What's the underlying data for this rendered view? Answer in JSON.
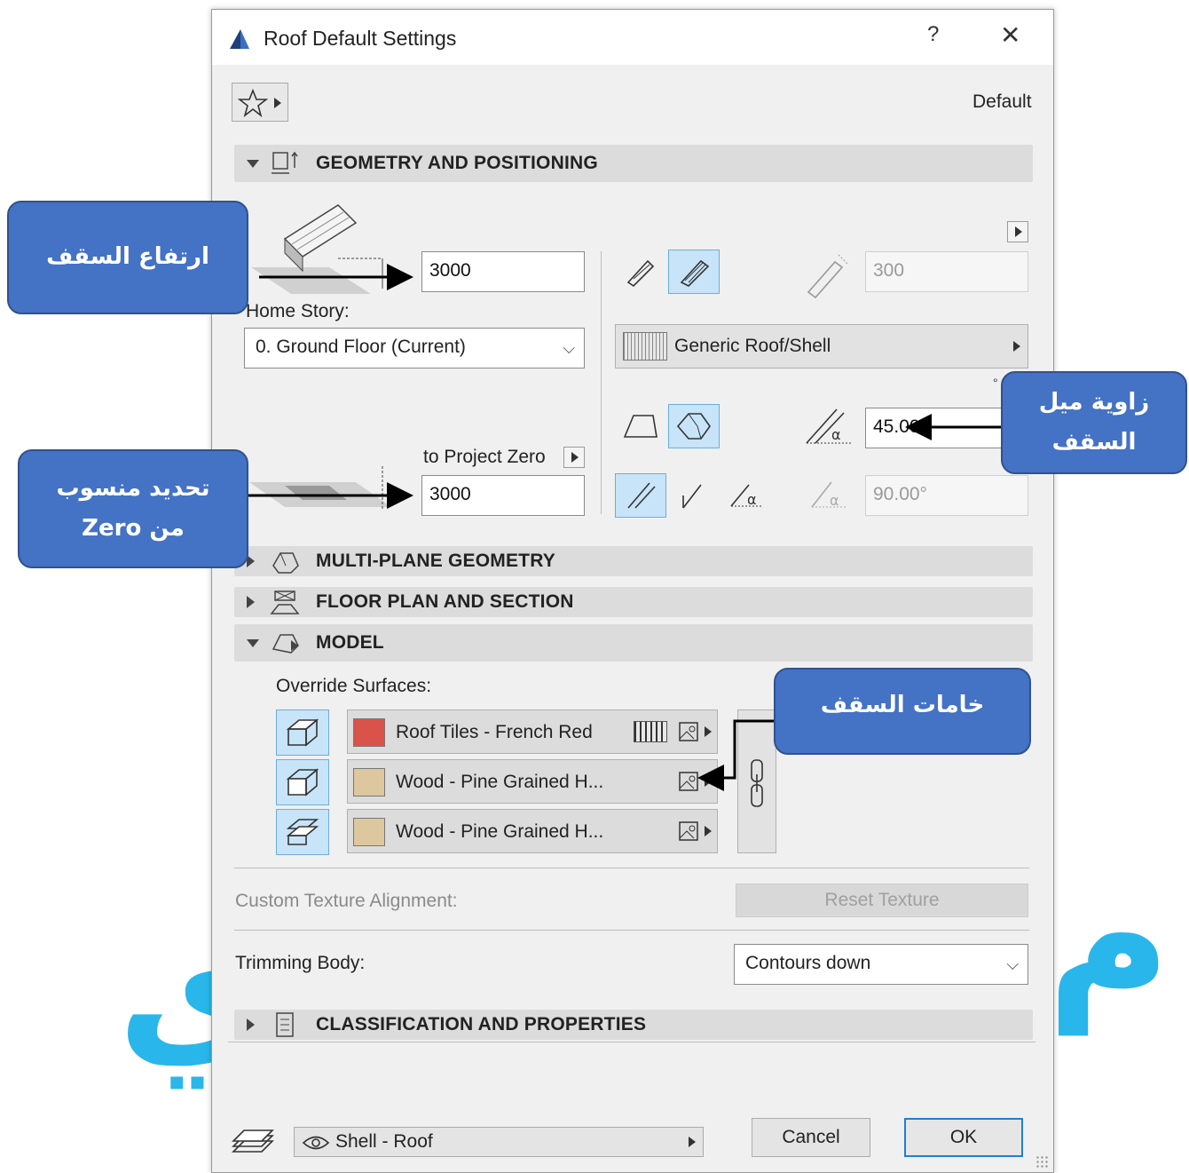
{
  "dialog": {
    "title": "Roof Default Settings",
    "help": "?",
    "close": "✕",
    "favorites_label": "Default"
  },
  "sections": {
    "geometry": "GEOMETRY AND POSITIONING",
    "multiplane": "MULTI-PLANE GEOMETRY",
    "floorplan": "FLOOR PLAN AND SECTION",
    "model": "MODEL",
    "classification": "CLASSIFICATION AND PROPERTIES"
  },
  "geometry": {
    "roof_height": "3000",
    "home_story_label": "Home Story:",
    "home_story_value": "0. Ground Floor (Current)",
    "to_project_zero_label": "to Project Zero",
    "project_zero_value": "3000",
    "thickness": "300",
    "composite": "Generic Roof/Shell",
    "pitch_angle": "45.00°",
    "edge_angle": "90.00°",
    "degree_mark": "°"
  },
  "model": {
    "override_label": "Override Surfaces:",
    "surfaces": [
      {
        "name": "Roof Tiles - French Red",
        "color": "#d9534a"
      },
      {
        "name": "Wood - Pine Grained H...",
        "color": "#dcc79e"
      },
      {
        "name": "Wood - Pine Grained H...",
        "color": "#dcc79e"
      }
    ],
    "texture_label": "Custom Texture Alignment:",
    "reset_texture": "Reset Texture",
    "trimming_label": "Trimming Body:",
    "trimming_value": "Contours down"
  },
  "footer": {
    "layer": "Shell - Roof",
    "cancel": "Cancel",
    "ok": "OK"
  },
  "callouts": {
    "roof_height": "ارتفاع السقف",
    "roof_angle": "زاوية ميل السقف",
    "project_zero": "تحديد منسوب من Zero",
    "roof_materials": "خامات السقف"
  },
  "colors": {
    "callout_fill": "#4472c4",
    "selected_button": "#c8e4f8",
    "ok_border": "#1e7fd6",
    "watermark": "#29b6ea"
  }
}
